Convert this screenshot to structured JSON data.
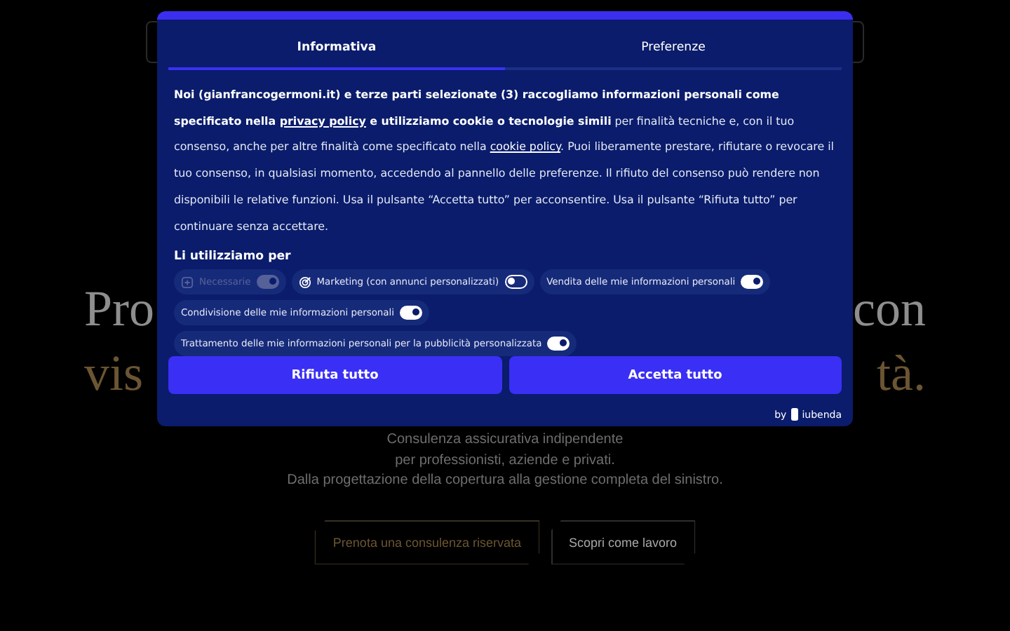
{
  "hero": {
    "heading_lines": [
      {
        "left": "Pro",
        "right": "con"
      },
      {
        "left": "vis",
        "right": "tà."
      }
    ],
    "subtitle_lines": [
      "Consulenza assicurativa indipendente",
      "per professionisti, aziende e privati.",
      "Dalla progettazione della copertura alla gestione completa del sinistro."
    ],
    "buttons": [
      {
        "label": "Prenota una consulenza riservata",
        "kind": "primary"
      },
      {
        "label": "Scopri come lavoro",
        "kind": "secondary"
      }
    ]
  },
  "consent_dialog": {
    "tabs": [
      {
        "label": "Informativa",
        "selected": true
      },
      {
        "label": "Preferenze",
        "selected": false
      }
    ],
    "notice": [
      {
        "kind": "bold",
        "text": "Noi (gianfrancogermoni.it) e terze parti selezionate (3) raccogliamo informazioni personali come specificato nella "
      },
      {
        "kind": "link",
        "bold": true,
        "text": "privacy policy"
      },
      {
        "kind": "bold",
        "text": " e utilizziamo cookie o tecnologie simili"
      },
      {
        "kind": "text",
        "text": " per finalità tecniche e, con il tuo consenso, anche per altre finalità come specificato nella "
      },
      {
        "kind": "link",
        "bold": false,
        "text": "cookie policy"
      },
      {
        "kind": "text",
        "text": ". Puoi liberamente prestare, rifiutare o revocare il tuo consenso, in qualsiasi momento, accedendo al pannello delle preferenze. Il rifiuto del consenso può rendere non disponibili le relative funzioni. Usa il pulsante “Accetta tutto” per acconsentire. Usa il pulsante “Rifiuta tutto” per continuare senza accettare."
      }
    ],
    "purposes_heading": "Li utilizziamo per",
    "purposes": [
      {
        "label": "Necessarie",
        "on": true,
        "disabled": true
      },
      {
        "label": "Marketing (con annunci personalizzati)",
        "on": false,
        "disabled": false
      },
      {
        "label": "Vendita delle mie informazioni personali",
        "on": true,
        "disabled": false
      },
      {
        "label": "Condivisione delle mie informazioni personali",
        "on": true,
        "disabled": false
      },
      {
        "label": "Trattamento delle mie informazioni personali per la pubblicità personalizzata",
        "on": true,
        "disabled": false
      }
    ],
    "buttons": [
      "Rifiuta tutto",
      "Accetta tutto"
    ],
    "credit": {
      "prefix": "by",
      "brand": "iubenda"
    }
  }
}
